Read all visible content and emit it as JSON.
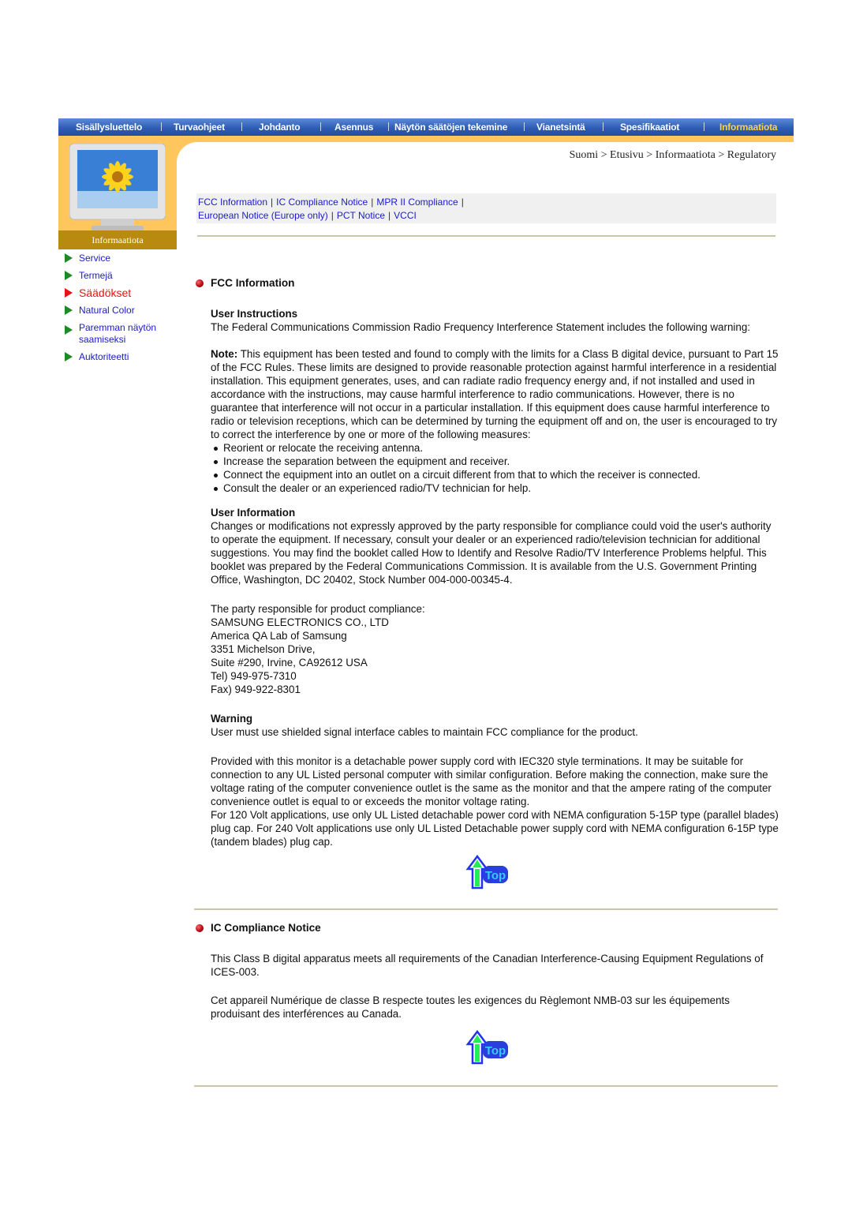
{
  "nav": {
    "items": [
      {
        "label": "Sisällysluettelo",
        "active": false
      },
      {
        "label": "Turvaohjeet",
        "active": false
      },
      {
        "label": "Johdanto",
        "active": false
      },
      {
        "label": "Asennus",
        "active": false
      },
      {
        "label": "Näytön säätöjen tekemine",
        "active": false
      },
      {
        "label": "Vianetsintä",
        "active": false
      },
      {
        "label": "Spesifikaatiot",
        "active": false
      },
      {
        "label": "Informaatiota",
        "active": true
      }
    ]
  },
  "sidebar": {
    "caption": "Informaatiota",
    "links": [
      {
        "label": "Service",
        "active": false
      },
      {
        "label": "Termejä",
        "active": false
      },
      {
        "label": "Säädökset",
        "active": true
      },
      {
        "label": "Natural Color",
        "active": false
      },
      {
        "label": "Paremman näytön saamiseksi",
        "active": false
      },
      {
        "label": "Auktoriteetti",
        "active": false
      }
    ]
  },
  "breadcrumb": "Suomi > Etusivu > Informaatiota > Regulatory",
  "subnav": {
    "row1": [
      "FCC Information",
      "IC Compliance Notice",
      "MPR II Compliance"
    ],
    "row2": [
      "European Notice (Europe only)",
      "PCT Notice",
      "VCCI"
    ]
  },
  "fcc": {
    "title": "FCC Information",
    "user_instructions_head": "User Instructions",
    "user_instructions_text": "The Federal Communications Commission Radio Frequency Interference Statement includes the following warning:",
    "note_label": "Note:",
    "note_text": " This equipment has been tested and found to comply with the limits for a Class B digital device, pursuant to Part 15 of the FCC Rules. These limits are designed to provide reasonable protection against harmful interference in a residential installation. This equipment generates, uses, and can radiate radio frequency energy and, if not installed and used in accordance with the instructions, may cause harmful interference to radio communications. However, there is no guarantee that interference will not occur in a particular installation. If this equipment does cause harmful interference to radio or television receptions, which can be determined by turning the equipment off and on, the user is encouraged to try to correct the interference by one or more of the following measures:",
    "measures": [
      "Reorient or relocate the receiving antenna.",
      "Increase the separation between the equipment and receiver.",
      "Connect the equipment into an outlet on a circuit different from that to which the receiver is connected.",
      "Consult the dealer or an experienced radio/TV technician for help."
    ],
    "user_information_head": "User Information",
    "user_information_text": "Changes or modifications not expressly approved by the party responsible for compliance could void the user's authority to operate the equipment. If necessary, consult your dealer or an experienced radio/television technician for additional suggestions. You may find the booklet called How to Identify and Resolve Radio/TV Interference Problems helpful. This booklet was prepared by the Federal Communications Commission. It is available from the U.S. Government Printing Office, Washington, DC 20402, Stock Number 004-000-00345-4.",
    "party_lines": [
      "The party responsible for product compliance:",
      "SAMSUNG ELECTRONICS CO., LTD",
      "America QA Lab of Samsung",
      "3351 Michelson Drive,",
      "Suite #290, Irvine, CA92612 USA",
      "Tel) 949-975-7310",
      "Fax) 949-922-8301"
    ],
    "warning_head": "Warning",
    "warning_text": "User must use shielded signal interface cables to maintain FCC compliance for the product.",
    "power_text": "Provided with this monitor is a detachable power supply cord with IEC320 style terminations. It may be suitable for connection to any UL Listed personal computer with similar configuration. Before making the connection, make sure the voltage rating of the computer convenience outlet is the same as the monitor and that the ampere rating of the computer convenience outlet is equal to or exceeds the monitor voltage rating.",
    "volt_text": "For 120 Volt applications, use only UL Listed detachable power cord with NEMA configuration 5-15P type (parallel blades) plug cap. For 240 Volt applications use only UL Listed Detachable power supply cord with NEMA configuration 6-15P type (tandem blades) plug cap."
  },
  "ic": {
    "title": "IC Compliance Notice",
    "text_en": "This Class B digital apparatus meets all requirements of the Canadian Interference-Causing Equipment Regulations of ICES-003.",
    "text_fr": "Cet appareil Numérique de classe B respecte toutes les exigences du Règlemont NMB-03 sur les équipements produisant des interférences au Canada."
  },
  "top_button": {
    "label": "Top",
    "icon": "top-arrow-icon"
  }
}
